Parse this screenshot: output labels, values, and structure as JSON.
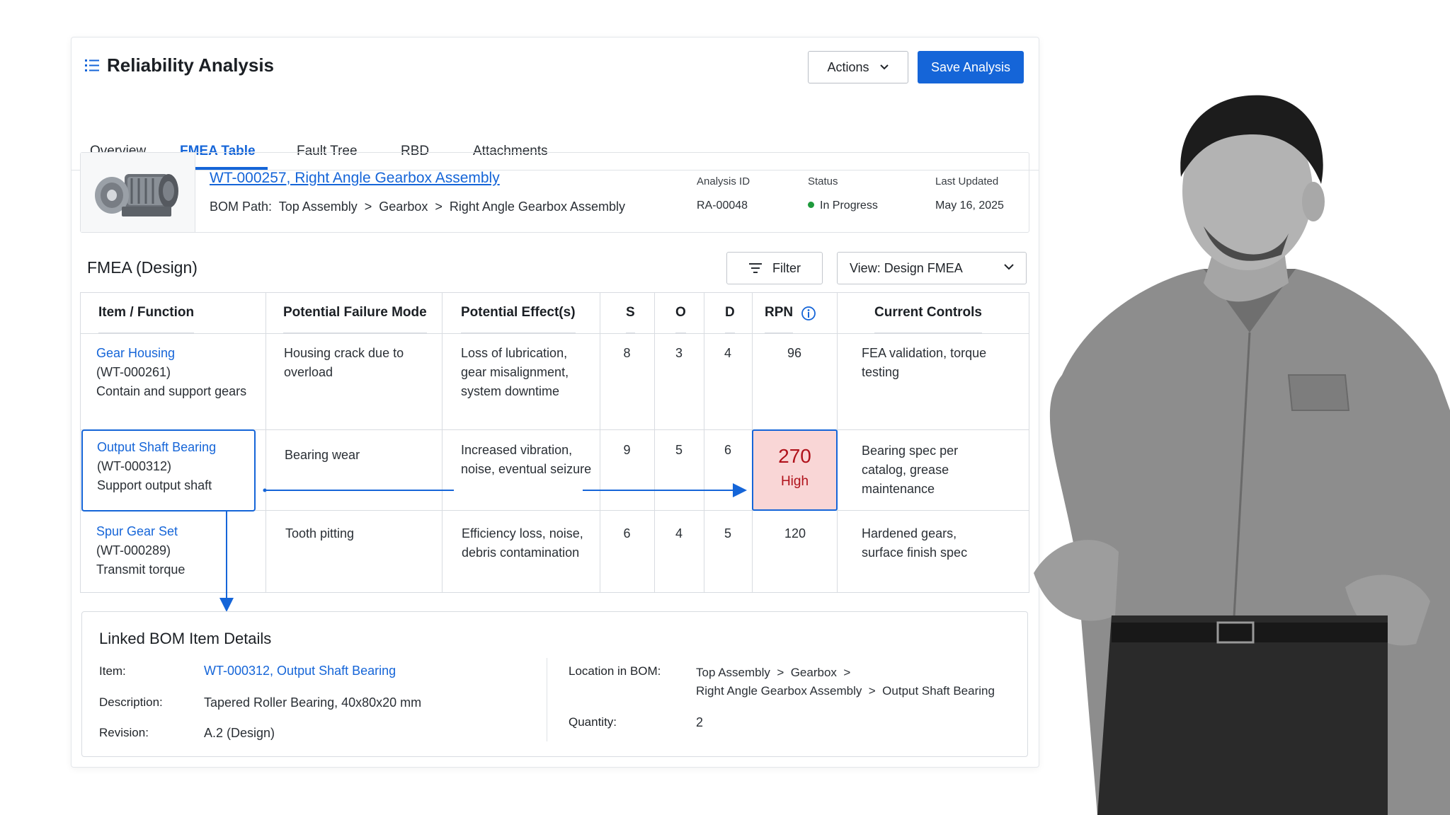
{
  "app": {
    "title": "Reliability Analysis",
    "icon": "list-icon"
  },
  "toolbar": {
    "actions_label": "Actions",
    "save_label": "Save Analysis"
  },
  "tabs": [
    {
      "label": "Overview",
      "active": false
    },
    {
      "label": "FMEA Table",
      "active": true
    },
    {
      "label": "Fault Tree",
      "active": false
    },
    {
      "label": "RBD",
      "active": false
    },
    {
      "label": "Attachments",
      "active": false
    }
  ],
  "part": {
    "link": "WT-000257, Right Angle Gearbox Assembly",
    "bom_path_label": "BOM Path:",
    "bom_path": [
      "Top Assembly",
      "Gearbox",
      "Right Angle Gearbox Assembly"
    ],
    "analysis_id_label": "Analysis ID",
    "analysis_id": "RA-00048",
    "status_label": "Status",
    "status": "In Progress",
    "last_updated_label": "Last Updated",
    "last_updated": "May 16, 2025"
  },
  "fmea": {
    "title": "FMEA (Design)",
    "filter_label": "Filter",
    "view_label": "View: Design FMEA",
    "columns": [
      "Item / Function",
      "Potential Failure Mode",
      "Potential Effect(s)",
      "S",
      "O",
      "D",
      "RPN",
      "Current Controls"
    ],
    "rows": [
      {
        "item": "Gear Housing",
        "id": "(WT-000261)",
        "function": "Contain and support gears",
        "failure_mode": "Housing crack due to overload",
        "effects": "Loss of lubrication, gear misalignment, system downtime",
        "s": "8",
        "o": "3",
        "d": "4",
        "rpn": "96",
        "controls": "FEA validation, torque testing"
      },
      {
        "item": "Output Shaft Bearing",
        "id": "(WT-000312)",
        "function": "Support output shaft",
        "failure_mode": "Bearing wear",
        "effects": "Increased vibration, noise, eventual seizure",
        "s": "9",
        "o": "5",
        "d": "6",
        "rpn": "270",
        "rpn_level": "High",
        "controls": "Bearing spec per catalog, grease maintenance"
      },
      {
        "item": "Spur Gear Set",
        "id": "(WT-000289)",
        "function": "Transmit torque",
        "failure_mode": "Tooth pitting",
        "effects": "Efficiency loss, noise, debris contamination",
        "s": "6",
        "o": "4",
        "d": "5",
        "rpn": "120",
        "controls": "Hardened gears, surface finish spec"
      }
    ]
  },
  "details": {
    "title": "Linked BOM Item Details",
    "item_label": "Item:",
    "item": "WT-000312, Output Shaft Bearing",
    "description_label": "Description:",
    "description": "Tapered Roller Bearing, 40x80x20 mm",
    "revision_label": "Revision:",
    "revision": "A.2 (Design)",
    "location_label": "Location in BOM:",
    "location_line1": "Top Assembly  >  Gearbox  >",
    "location_line2": "Right Angle Gearbox Assembly  >  Output Shaft Bearing",
    "quantity_label": "Quantity:",
    "quantity": "2"
  },
  "colors": {
    "accent": "#1565d8",
    "high_risk_bg": "#f9d6d6",
    "high_risk_text": "#b0121b",
    "status_ok": "#1e9a3c"
  }
}
